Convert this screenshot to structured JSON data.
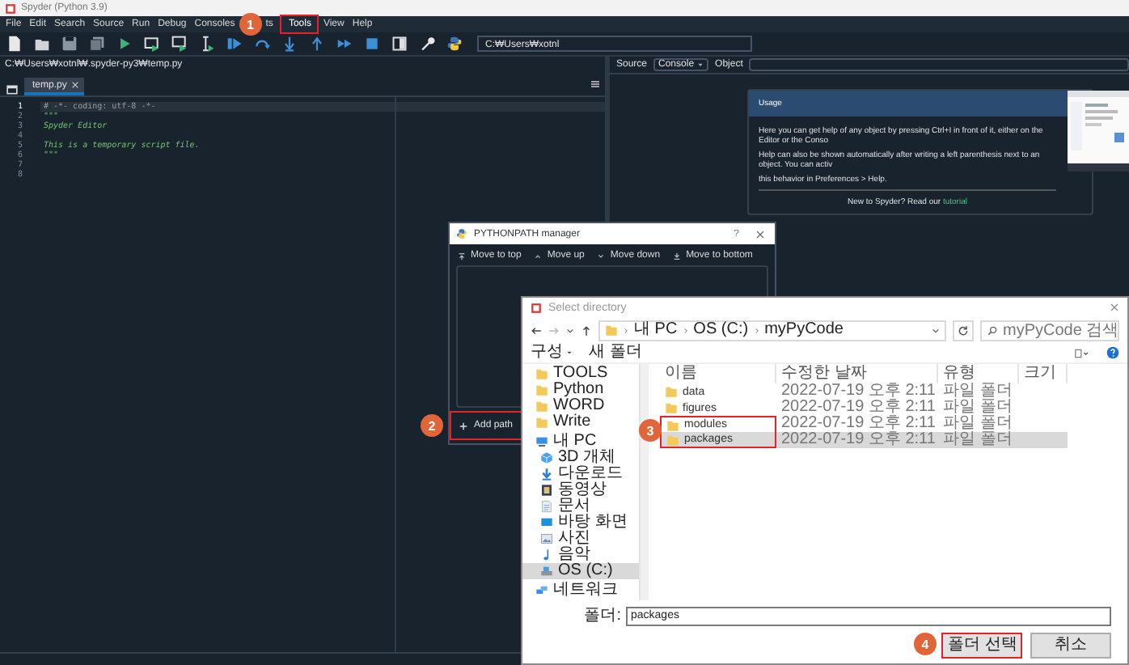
{
  "window": {
    "title": "Spyder (Python 3.9)"
  },
  "menu": [
    {
      "kind": "item",
      "label": "File",
      "highlighted": false
    },
    {
      "kind": "item",
      "label": "Edit",
      "highlighted": false
    },
    {
      "kind": "item",
      "label": "Search",
      "highlighted": false
    },
    {
      "kind": "item",
      "label": "Source",
      "highlighted": false
    },
    {
      "kind": "item",
      "label": "Run",
      "highlighted": false
    },
    {
      "kind": "item",
      "label": "Debug",
      "highlighted": false
    },
    {
      "kind": "item",
      "label": "Consoles",
      "highlighted": false
    },
    {
      "kind": "callout",
      "number": "1"
    },
    {
      "kind": "item",
      "label": "ts",
      "highlighted": false
    },
    {
      "kind": "item",
      "label": "Tools",
      "highlighted": true
    },
    {
      "kind": "item",
      "label": "View",
      "highlighted": false
    },
    {
      "kind": "item",
      "label": "Help",
      "highlighted": false
    }
  ],
  "toolbar": {
    "working_directory": "C:₩Users₩xotnl"
  },
  "editor": {
    "path": "C:₩Users₩xotnl₩.spyder-py3₩temp.py",
    "tabs": [
      {
        "label": "temp.py",
        "selected": true
      }
    ],
    "lines": [
      {
        "number": "1",
        "text": "# -*- coding: utf-8 -*-",
        "kind": "comment",
        "current": true
      },
      {
        "number": "2",
        "text": "\"\"\"",
        "kind": "docstring",
        "current": false
      },
      {
        "number": "3",
        "text": "Spyder Editor",
        "kind": "docstring",
        "current": false
      },
      {
        "number": "4",
        "current": false
      },
      {
        "number": "5",
        "text": "This is a temporary script file.",
        "kind": "docstring",
        "current": false
      },
      {
        "number": "6",
        "text": "\"\"\"",
        "kind": "docstring",
        "current": false
      },
      {
        "number": "7",
        "current": false
      },
      {
        "number": "8",
        "current": false
      }
    ]
  },
  "help": {
    "source_label": "Source",
    "source": "Console",
    "object_label": "Object",
    "usage": {
      "title": "Usage",
      "texts": [
        "Here you can get help of any object by pressing Ctrl+I in front of it, either on the Editor or the Conso",
        "Help can also be shown automatically after writing a left parenthesis next to an object. You can activ",
        "this behavior in Preferences > Help."
      ],
      "footer": "New to Spyder? Read our",
      "link": "tutorial"
    }
  },
  "pythonpath_manager": {
    "title": "PYTHONPATH manager",
    "help": "?",
    "buttons": [
      "Move to top",
      "Move up",
      "Move down",
      "Move to bottom"
    ],
    "add_path": {
      "label": "Add path",
      "highlighted": true,
      "callout": "2"
    }
  },
  "select_directory": {
    "title": "Select directory",
    "breadcrumb": [
      "내 PC",
      "OS (C:)",
      "myPyCode"
    ],
    "search_placeholder": "myPyCode 검색",
    "commands": [
      "구성",
      "새 폴더"
    ],
    "nav": [
      {
        "label": "TOOLS",
        "kind": "folder",
        "selected": false
      },
      {
        "label": "Python",
        "kind": "folder",
        "selected": false
      },
      {
        "label": "WORD",
        "kind": "folder",
        "selected": false
      },
      {
        "label": "Write",
        "kind": "folder",
        "selected": false
      },
      {
        "label": "내 PC",
        "kind": "pc",
        "selected": false,
        "children": [
          {
            "label": "3D 개체",
            "kind": "objects",
            "selected": false
          },
          {
            "label": "다운로드",
            "kind": "download",
            "selected": false
          },
          {
            "label": "동영상",
            "kind": "video",
            "selected": false
          },
          {
            "label": "문서",
            "kind": "document",
            "selected": false
          },
          {
            "label": "바탕 화면",
            "kind": "desktop",
            "selected": false
          },
          {
            "label": "사진",
            "kind": "picture",
            "selected": false
          },
          {
            "label": "음악",
            "kind": "music",
            "selected": false
          },
          {
            "label": "OS (C:)",
            "kind": "drive",
            "selected": true
          }
        ]
      },
      {
        "label": "네트워크",
        "kind": "network",
        "selected": false
      }
    ],
    "columns": [
      "이름",
      "수정한 날짜",
      "유형",
      "크기"
    ],
    "rows": [
      {
        "name": "data",
        "modified": "2022-07-19 오후 2:11",
        "type": "파일 폴더",
        "selected": false,
        "highlighted": false
      },
      {
        "name": "figures",
        "modified": "2022-07-19 오후 2:11",
        "type": "파일 폴더",
        "selected": false,
        "highlighted": false
      },
      {
        "name": "modules",
        "modified": "2022-07-19 오후 2:11",
        "type": "파일 폴더",
        "selected": false,
        "highlighted": true
      },
      {
        "name": "packages",
        "modified": "2022-07-19 오후 2:11",
        "type": "파일 폴더",
        "selected": true,
        "highlighted": true
      }
    ],
    "rows_callout": "3",
    "folder_label": "폴더:",
    "folder_value": "packages",
    "buttons": [
      {
        "label": "폴더 선택",
        "highlighted": true,
        "callout": "4"
      },
      {
        "label": "취소",
        "highlighted": false
      }
    ]
  }
}
